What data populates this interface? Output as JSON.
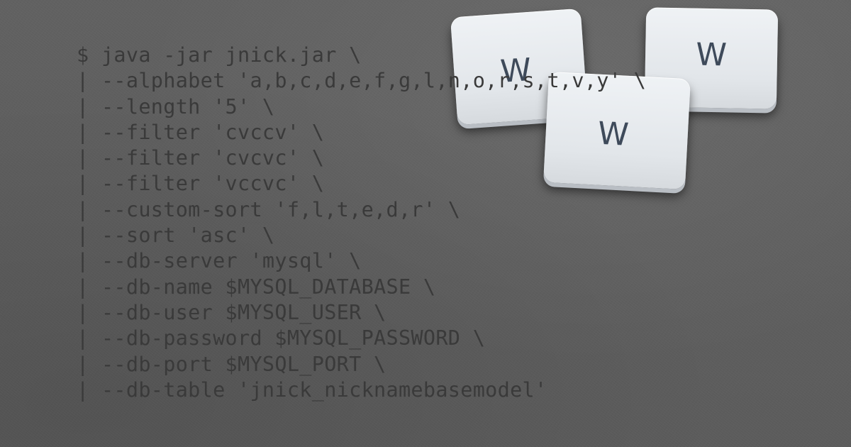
{
  "background": {
    "color": "#5f5f5f",
    "text_color": "#3a3a3a"
  },
  "tiles": [
    {
      "letter": "W"
    },
    {
      "letter": "W"
    },
    {
      "letter": "W"
    }
  ],
  "terminal": {
    "lines": [
      {
        "prefix": "$",
        "text": "java -jar jnick.jar \\"
      },
      {
        "prefix": "|",
        "text": "--alphabet 'a,b,c,d,e,f,g,l,n,o,r,s,t,v,y' \\"
      },
      {
        "prefix": "|",
        "text": "--length '5' \\"
      },
      {
        "prefix": "|",
        "text": "--filter 'cvccv' \\"
      },
      {
        "prefix": "|",
        "text": "--filter 'cvcvc' \\"
      },
      {
        "prefix": "|",
        "text": "--filter 'vccvc' \\"
      },
      {
        "prefix": "|",
        "text": "--custom-sort 'f,l,t,e,d,r' \\"
      },
      {
        "prefix": "|",
        "text": "--sort 'asc' \\"
      },
      {
        "prefix": "|",
        "text": "--db-server 'mysql' \\"
      },
      {
        "prefix": "|",
        "text": "--db-name $MYSQL_DATABASE \\"
      },
      {
        "prefix": "|",
        "text": "--db-user $MYSQL_USER \\"
      },
      {
        "prefix": "|",
        "text": "--db-password $MYSQL_PASSWORD \\"
      },
      {
        "prefix": "|",
        "text": "--db-port $MYSQL_PORT \\"
      },
      {
        "prefix": "|",
        "text": "--db-table 'jnick_nicknamebasemodel'"
      }
    ]
  }
}
